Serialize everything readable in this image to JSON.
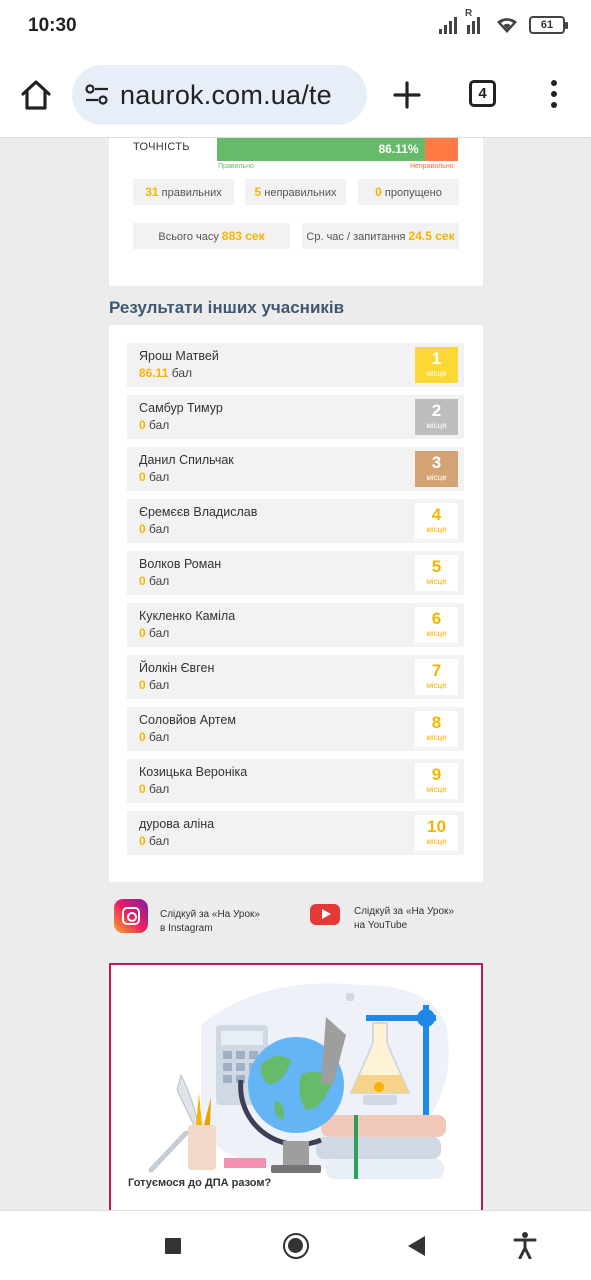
{
  "status_bar": {
    "time": "10:30",
    "battery": "61",
    "icons": [
      "signal-icon",
      "signal-roaming-icon",
      "wifi-icon",
      "battery-icon"
    ]
  },
  "browser": {
    "url": "naurok.com.ua/te",
    "tab_count": "4",
    "icons": [
      "home-icon",
      "site-settings-icon",
      "new-tab-icon",
      "tabs-icon",
      "more-menu-icon"
    ]
  },
  "results": {
    "accuracy_label": "ТОЧНІСТЬ",
    "accuracy_value": "86.11%",
    "accuracy_fraction": 0.8611,
    "correct_label": "Правильно",
    "incorrect_label": "Неправильно",
    "correct_count": "31",
    "correct_text": "правильних",
    "incorrect_count": "5",
    "incorrect_text": "неправильних",
    "skipped_count": "0",
    "skipped_text": "пропущено",
    "total_time_label": "Всього часу",
    "total_time_value": "883 сек",
    "avg_time_label": "Ср. час / запитання",
    "avg_time_value": "24.5 сек",
    "colors": {
      "correct": "#66bb6a",
      "incorrect": "#ff7a45",
      "highlight": "#f5b400"
    }
  },
  "participants": {
    "title": "Результати інших учасників",
    "points_word": "бал",
    "place_word": "місце",
    "list": [
      {
        "name": "Ярош Матвей",
        "score": "86.11",
        "place": "1"
      },
      {
        "name": "Самбур Тимур",
        "score": "0",
        "place": "2"
      },
      {
        "name": "Данил Спильчак",
        "score": "0",
        "place": "3"
      },
      {
        "name": "Єремєєв Владислав",
        "score": "0",
        "place": "4"
      },
      {
        "name": "Волков Роман",
        "score": "0",
        "place": "5"
      },
      {
        "name": "Кукленко Каміла",
        "score": "0",
        "place": "6"
      },
      {
        "name": "Йолкін Євген",
        "score": "0",
        "place": "7"
      },
      {
        "name": "Соловйов Артем",
        "score": "0",
        "place": "8"
      },
      {
        "name": "Козицька Вероніка",
        "score": "0",
        "place": "9"
      },
      {
        "name": "дурова аліна",
        "score": "0",
        "place": "10"
      }
    ]
  },
  "social": {
    "instagram_line1": "Слідкуй за «На Урок»",
    "instagram_line2": "в Instagram",
    "youtube_line1": "Слідкуй за «На Урок»",
    "youtube_line2": "на YouTube"
  },
  "promo": {
    "title": "Готуємося до ДПА разом?"
  },
  "navbar": {
    "icons": [
      "recent-apps-icon",
      "home-circle-icon",
      "back-icon",
      "accessibility-icon"
    ]
  }
}
